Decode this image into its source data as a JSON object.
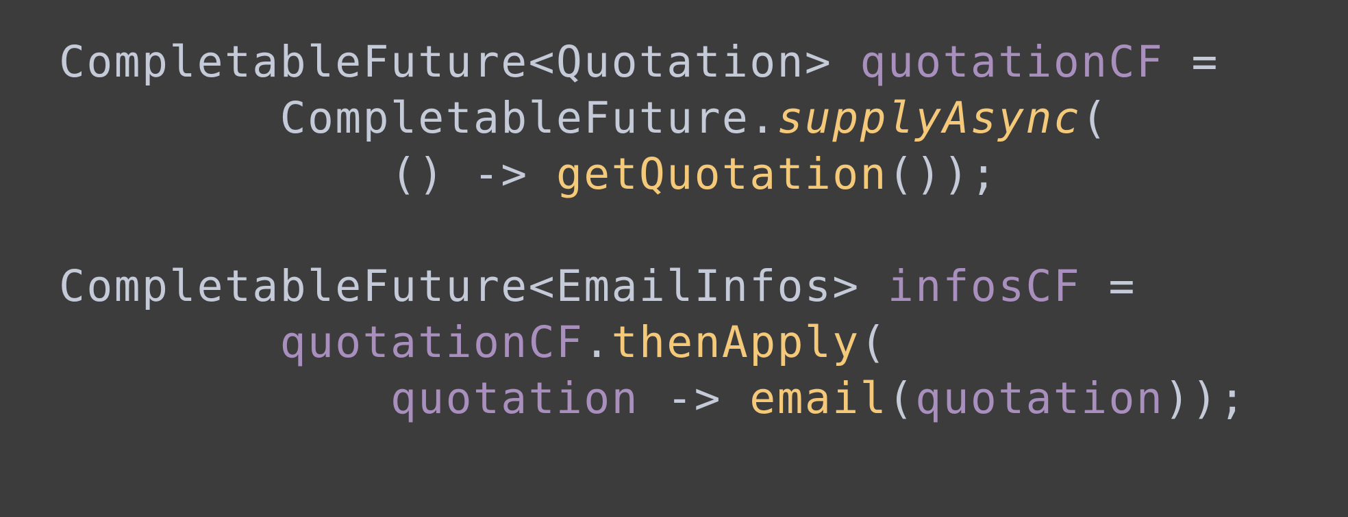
{
  "colors": {
    "background": "#3c3c3c",
    "plain": "#c5cad8",
    "variable": "#a98fbd",
    "method": "#f5c97a"
  },
  "code": {
    "lines": [
      {
        "indent": 0,
        "tokens": [
          {
            "text": "CompletableFuture<Quotation> ",
            "kind": "plain"
          },
          {
            "text": "quotationCF",
            "kind": "var"
          },
          {
            "text": " =",
            "kind": "plain"
          }
        ]
      },
      {
        "indent": 8,
        "tokens": [
          {
            "text": "CompletableFuture.",
            "kind": "plain"
          },
          {
            "text": "supplyAsync",
            "kind": "static"
          },
          {
            "text": "(",
            "kind": "plain"
          }
        ]
      },
      {
        "indent": 12,
        "tokens": [
          {
            "text": "() -> ",
            "kind": "plain"
          },
          {
            "text": "getQuotation",
            "kind": "method"
          },
          {
            "text": "());",
            "kind": "plain"
          }
        ]
      },
      {
        "indent": 0,
        "tokens": []
      },
      {
        "indent": 0,
        "tokens": [
          {
            "text": "CompletableFuture<EmailInfos> ",
            "kind": "plain"
          },
          {
            "text": "infosCF",
            "kind": "var"
          },
          {
            "text": " =",
            "kind": "plain"
          }
        ]
      },
      {
        "indent": 8,
        "tokens": [
          {
            "text": "quotationCF",
            "kind": "var"
          },
          {
            "text": ".",
            "kind": "plain"
          },
          {
            "text": "thenApply",
            "kind": "method"
          },
          {
            "text": "(",
            "kind": "plain"
          }
        ]
      },
      {
        "indent": 12,
        "tokens": [
          {
            "text": "quotation",
            "kind": "var"
          },
          {
            "text": " -> ",
            "kind": "plain"
          },
          {
            "text": "email",
            "kind": "method"
          },
          {
            "text": "(",
            "kind": "plain"
          },
          {
            "text": "quotation",
            "kind": "var"
          },
          {
            "text": "));",
            "kind": "plain"
          }
        ]
      }
    ]
  }
}
